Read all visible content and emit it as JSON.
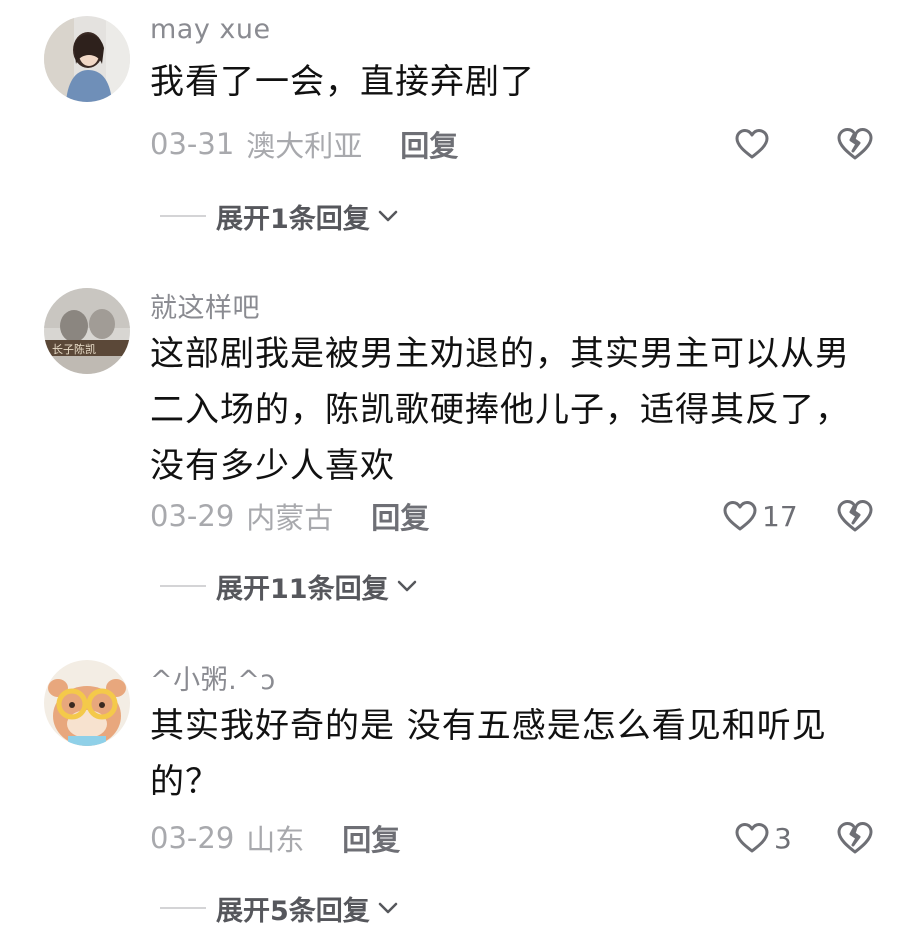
{
  "comments": [
    {
      "username": "may xue",
      "text": "我看了一会，直接弃剧了",
      "date": "03-31",
      "location": "澳大利亚",
      "reply_label": "回复",
      "like_count": "",
      "expand_label": "展开1条回复"
    },
    {
      "username": "就这样吧",
      "text": "这部剧我是被男主劝退的，其实男主可以从男二入场的，陈凯歌硬捧他儿子，适得其反了，没有多少人喜欢",
      "date": "03-29",
      "location": "内蒙古",
      "reply_label": "回复",
      "like_count": "17",
      "expand_label": "展开11条回复"
    },
    {
      "username": "^小粥.^ↄ",
      "text": "其实我好奇的是 没有五感是怎么看见和听见的？",
      "date": "03-29",
      "location": "山东",
      "reply_label": "回复",
      "like_count": "3",
      "expand_label": "展开5条回复"
    }
  ],
  "icons": {
    "like": "heart-outline-icon",
    "dislike": "broken-heart-icon",
    "expand": "chevron-down-icon"
  },
  "colors": {
    "username": "#8a8b91",
    "text": "#111111",
    "meta": "#a8a9ad",
    "reply": "#6e6f75"
  }
}
